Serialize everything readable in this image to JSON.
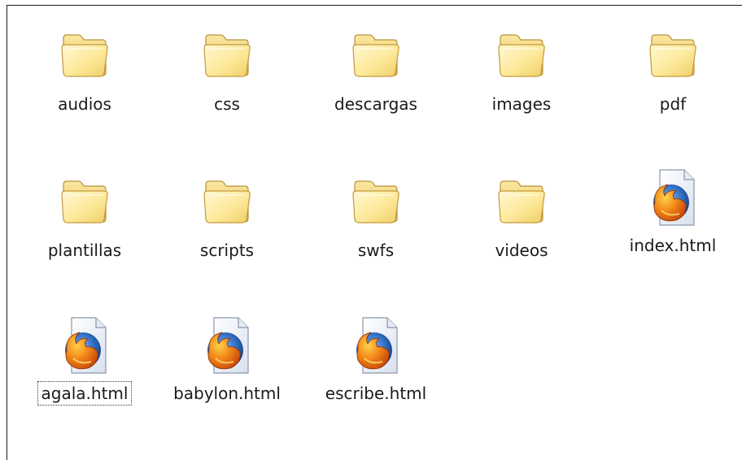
{
  "window": {
    "view": "icons"
  },
  "items": [
    {
      "label": "audios",
      "type": "folder",
      "icon": "folder-icon"
    },
    {
      "label": "css",
      "type": "folder",
      "icon": "folder-icon"
    },
    {
      "label": "descargas",
      "type": "folder",
      "icon": "folder-icon"
    },
    {
      "label": "images",
      "type": "folder",
      "icon": "folder-icon"
    },
    {
      "label": "pdf",
      "type": "folder",
      "icon": "folder-icon"
    },
    {
      "label": "plantillas",
      "type": "folder",
      "icon": "folder-icon"
    },
    {
      "label": "scripts",
      "type": "folder",
      "icon": "folder-icon"
    },
    {
      "label": "swfs",
      "type": "folder",
      "icon": "folder-icon"
    },
    {
      "label": "videos",
      "type": "folder",
      "icon": "folder-icon"
    },
    {
      "label": "index.html",
      "type": "html",
      "icon": "firefox-html-file-icon"
    },
    {
      "label": "agala.html",
      "type": "html",
      "icon": "firefox-html-file-icon",
      "focused": true
    },
    {
      "label": "babylon.html",
      "type": "html",
      "icon": "firefox-html-file-icon"
    },
    {
      "label": "escribe.html",
      "type": "html",
      "icon": "firefox-html-file-icon"
    }
  ],
  "colors": {
    "folder_light": "#fff3b8",
    "folder_mid": "#f6dc7a",
    "folder_dark": "#d8b24a",
    "firefox_orange": "#e66000",
    "firefox_blue": "#2f6fc4",
    "paper": "#eef2f9"
  }
}
